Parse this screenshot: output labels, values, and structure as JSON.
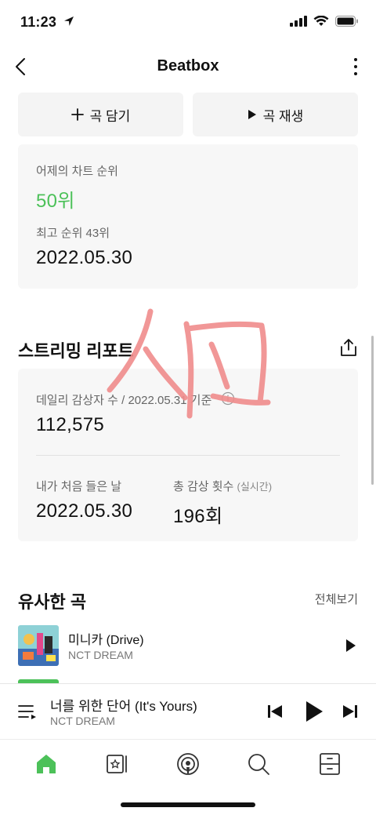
{
  "status": {
    "time": "11:23"
  },
  "nav": {
    "title": "Beatbox"
  },
  "actions": {
    "add_label": "곡 담기",
    "play_label": "곡 재생"
  },
  "chart": {
    "yesterday_label": "어제의 차트 순위",
    "yesterday_rank": "50위",
    "best_rank_label": "최고 순위 43위",
    "best_rank_date": "2022.05.30"
  },
  "streaming": {
    "title": "스트리밍 리포트",
    "daily_label": "데일리 감상자 수 / 2022.05.31 기준",
    "daily_value": "112,575",
    "first_listen_label": "내가 처음 들은 날",
    "first_listen_date": "2022.05.30",
    "total_label": "총 감상 횟수",
    "total_sub": "(실시간)",
    "total_value": "196회"
  },
  "similar": {
    "title": "유사한 곡",
    "see_all": "전체보기",
    "songs": [
      {
        "title": "미니카 (Drive)",
        "artist": "NCT DREAM"
      }
    ]
  },
  "player": {
    "title": "너를 위한 단어 (It's Yours)",
    "artist": "NCT DREAM"
  },
  "colors": {
    "accent": "#4cc159",
    "card_bg": "#f7f7f7",
    "doodle": "#f08c8c"
  },
  "icons": {
    "tabs": [
      "home-icon",
      "library-icon",
      "podcast-icon",
      "search-icon",
      "drawer-icon"
    ]
  }
}
